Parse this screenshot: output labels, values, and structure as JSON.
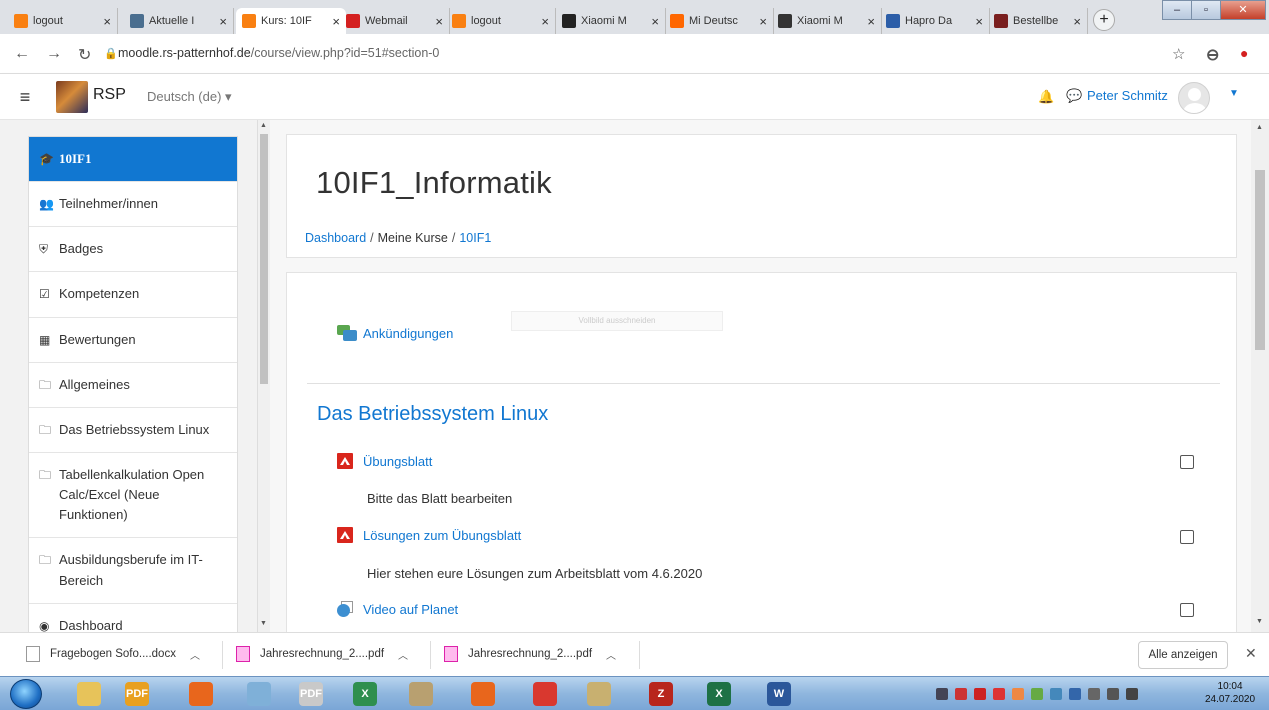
{
  "browser": {
    "tabs": [
      {
        "title": "logout",
        "icon": "moodle-m-icon",
        "color": "#f98012"
      },
      {
        "title": "Aktuelle I",
        "icon": "page-icon",
        "color": "#4a6e8f"
      },
      {
        "title": "Kurs: 10IF",
        "icon": "moodle-m-icon",
        "color": "#f98012"
      },
      {
        "title": "Webmail",
        "icon": "mail-icon",
        "color": "#d42020"
      },
      {
        "title": "logout",
        "icon": "moodle-m-icon",
        "color": "#f98012"
      },
      {
        "title": "Xiaomi M",
        "icon": "xiaomi-icon",
        "color": "#222222"
      },
      {
        "title": "Mi Deutsc",
        "icon": "mi-icon",
        "color": "#ff6700"
      },
      {
        "title": "Xiaomi M",
        "icon": "amazon-icon",
        "color": "#333333"
      },
      {
        "title": "Hapro Da",
        "icon": "table-icon",
        "color": "#2c5ea8"
      },
      {
        "title": "Bestellbe",
        "icon": "xf-icon",
        "color": "#7a1f1f"
      }
    ],
    "new_tab_label": "+",
    "url_host": "moodle.rs-patternhof.de",
    "url_path": "/course/view.php?id=51#section-0"
  },
  "navbar": {
    "site_name": "RSP",
    "language": "Deutsch (de) ▾",
    "user_name": "Peter Schmitz"
  },
  "drawer": {
    "items": [
      {
        "label": "10IF1",
        "icon": "graduation-cap-icon",
        "glyph": "🎓"
      },
      {
        "label": "Teilnehmer/innen",
        "icon": "users-icon",
        "glyph": "👥"
      },
      {
        "label": "Badges",
        "icon": "shield-icon",
        "glyph": "⛨"
      },
      {
        "label": "Kompetenzen",
        "icon": "checkbox-icon",
        "glyph": "☑"
      },
      {
        "label": "Bewertungen",
        "icon": "table-icon",
        "glyph": "▦"
      },
      {
        "label": "Allgemeines",
        "icon": "folder-icon",
        "glyph": "🗀"
      },
      {
        "label": "Das Betriebssystem Linux",
        "icon": "folder-icon",
        "glyph": "🗀"
      },
      {
        "label": "Tabellenkalkulation Open Calc/Excel (Neue Funktionen)",
        "icon": "folder-icon",
        "glyph": "🗀"
      },
      {
        "label": "Ausbildungsberufe im IT-Bereich",
        "icon": "folder-icon",
        "glyph": "🗀"
      },
      {
        "label": "Dashboard",
        "icon": "dashboard-icon",
        "glyph": "◉"
      }
    ]
  },
  "page": {
    "title": "10IF1_Informatik",
    "breadcrumb": [
      "Dashboard",
      "Meine Kurse",
      "10IF1"
    ],
    "announcements": "Ankündigungen",
    "tooltip": "Vollbild ausschneiden",
    "section_title": "Das Betriebssystem Linux",
    "activities": [
      {
        "label": "Übungsblatt",
        "icon": "pdf-icon",
        "description": "Bitte das Blatt bearbeiten"
      },
      {
        "label": "Lösungen zum Übungsblatt",
        "icon": "pdf-icon",
        "description": "Hier stehen eure Lösungen zum Arbeitsblatt vom 4.6.2020"
      },
      {
        "label": "Video auf Planet",
        "icon": "url-icon",
        "description": ""
      }
    ]
  },
  "downloads": {
    "items": [
      "Fragebogen Sofo....docx",
      "Jahresrechnung_2....pdf",
      "Jahresrechnung_2....pdf"
    ],
    "show_all": "Alle anzeigen"
  },
  "taskbar": {
    "apps": [
      {
        "icon": "explorer-icon",
        "color": "#e7c35a",
        "text": ""
      },
      {
        "icon": "pdf-app-icon",
        "color": "#e8a020",
        "text": "PDF"
      },
      {
        "icon": "firefox-icon",
        "color": "#e8661c",
        "text": ""
      },
      {
        "icon": "media-icon",
        "color": "#7fb0d8",
        "text": ""
      },
      {
        "icon": "pdf-doc-icon",
        "color": "#c9c9c9",
        "text": "PDF"
      },
      {
        "icon": "app-x-icon",
        "color": "#2e8f4e",
        "text": "X"
      },
      {
        "icon": "paint-icon",
        "color": "#b8a070",
        "text": ""
      },
      {
        "icon": "firefox-icon",
        "color": "#e8661c",
        "text": ""
      },
      {
        "icon": "chrome-icon",
        "color": "#d9382f",
        "text": ""
      },
      {
        "icon": "tools-icon",
        "color": "#c8b070",
        "text": ""
      },
      {
        "icon": "filezilla-icon",
        "color": "#b8261c",
        "text": "Z"
      },
      {
        "icon": "excel-icon",
        "color": "#1e7145",
        "text": "X"
      },
      {
        "icon": "word-icon",
        "color": "#2b579a",
        "text": "W"
      }
    ],
    "time": "10:04",
    "date": "24.07.2020"
  }
}
